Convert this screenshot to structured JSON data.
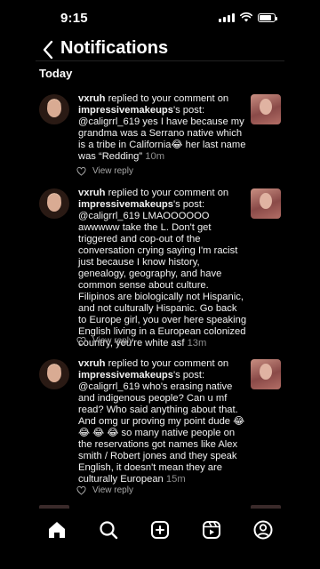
{
  "status_bar": {
    "time": "9:15"
  },
  "header": {
    "title": "Notifications"
  },
  "section": {
    "label": "Today"
  },
  "notifications": [
    {
      "username": "vxruh",
      "action": " replied to your comment on ",
      "target_account": "impressivemakeups",
      "post_suffix": "'s post: @caligrrl_619 yes I have because my grandma was a Serrano native which is a tribe in California😂 her last name was “Redding”",
      "time": "10m",
      "reply_label": "View reply"
    },
    {
      "username": "vxruh",
      "action": " replied to your comment on ",
      "target_account": "impressivemakeups",
      "post_suffix": "'s post: @caligrrl_619 LMAOOOOOO awwwww take the L. Don't get triggered and cop-out of the conversation crying saying I'm racist just because I know history, genealogy, geography, and have common sense about culture. Filipinos are biologically not Hispanic, and not culturally Hispanic. Go back to Europe girl, you over here speaking English living in a European colonized country, you're white asf",
      "time": "13m",
      "reply_label": "View reply"
    },
    {
      "username": "vxruh",
      "action": " replied to your comment on ",
      "target_account": "impressivemakeups",
      "post_suffix": "'s post: @caligrrl_619 who's erasing native and indigenous people? Can u mf read? Who said anything about that. And omg ur proving my point dude 😂 😂 😂 😂 so many native people on the reservations got names like Alex smith / Robert jones and they speak English, it doesn't mean they are culturally European",
      "time": "15m",
      "reply_label": "View reply"
    }
  ],
  "nav": {
    "items": [
      "home-icon",
      "search-icon",
      "create-icon",
      "reels-icon",
      "profile-icon"
    ]
  }
}
